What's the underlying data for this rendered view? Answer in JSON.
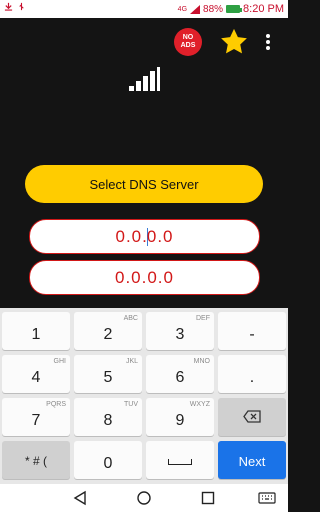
{
  "status_bar": {
    "battery": "88%",
    "time": "8:20 PM",
    "network": "4G"
  },
  "app_bar": {
    "noads_line1": "NO",
    "noads_line2": "ADS",
    "icons": [
      "noads-icon",
      "star-icon",
      "kebab-menu-icon"
    ]
  },
  "main": {
    "signal_icon": "signal-bars-icon",
    "select_button": "Select DNS Server",
    "dns1_part1": "0.0.",
    "dns1_part2": "0.0",
    "dns2": "0.0.0.0"
  },
  "keyboard": {
    "rows": [
      [
        {
          "num": "1",
          "sub": ""
        },
        {
          "num": "2",
          "sub": "ABC"
        },
        {
          "num": "3",
          "sub": "DEF"
        },
        {
          "num": "-",
          "sub": ""
        }
      ],
      [
        {
          "num": "4",
          "sub": "GHI"
        },
        {
          "num": "5",
          "sub": "JKL"
        },
        {
          "num": "6",
          "sub": "MNO"
        },
        {
          "num": ".",
          "sub": ""
        }
      ],
      [
        {
          "num": "7",
          "sub": "PQRS"
        },
        {
          "num": "8",
          "sub": "TUV"
        },
        {
          "num": "9",
          "sub": "WXYZ"
        },
        {
          "num": "",
          "sub": ""
        }
      ],
      [
        {
          "num": "* # (",
          "sub": ""
        },
        {
          "num": "0",
          "sub": ""
        },
        {
          "num": "",
          "sub": ""
        },
        {
          "num": "Next",
          "sub": ""
        }
      ]
    ]
  },
  "colors": {
    "accent_yellow": "#ffcc00",
    "field_red": "#d21818",
    "next_blue": "#1a73e8"
  }
}
